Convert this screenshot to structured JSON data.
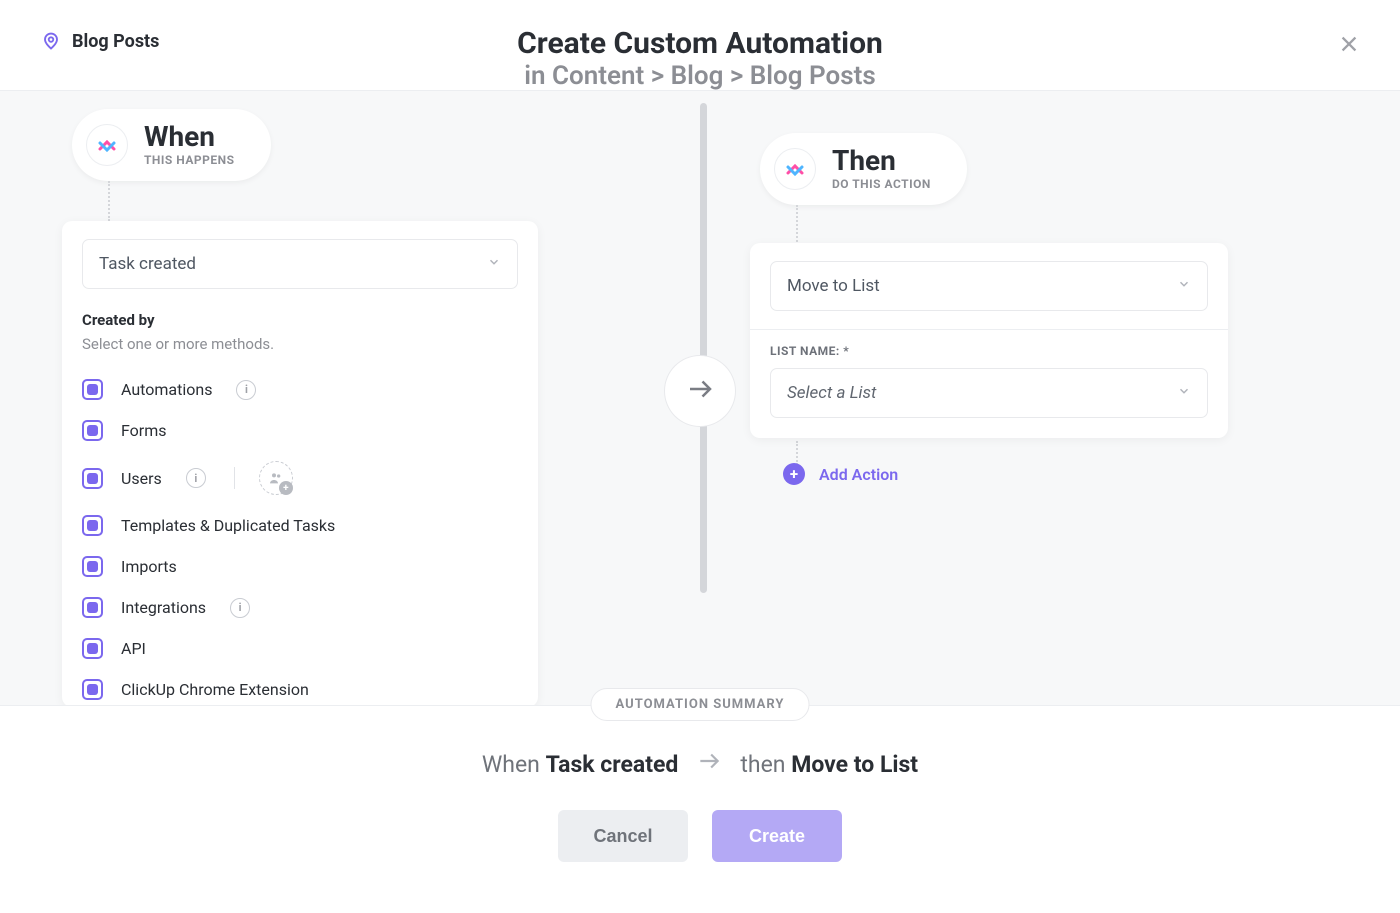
{
  "header": {
    "breadcrumb_label": "Blog Posts",
    "title": "Create Custom Automation",
    "path_prefix": "in ",
    "path": "Content > Blog > Blog Posts"
  },
  "when": {
    "pill_title": "When",
    "pill_sub": "THIS HAPPENS",
    "trigger_selected": "Task created",
    "created_by_label": "Created by",
    "created_by_sub": "Select one or more methods.",
    "methods": [
      {
        "label": "Automations",
        "info": true,
        "people": false
      },
      {
        "label": "Forms",
        "info": false,
        "people": false
      },
      {
        "label": "Users",
        "info": true,
        "people": true
      },
      {
        "label": "Templates & Duplicated Tasks",
        "info": false,
        "people": false
      },
      {
        "label": "Imports",
        "info": false,
        "people": false
      },
      {
        "label": "Integrations",
        "info": true,
        "people": false
      },
      {
        "label": "API",
        "info": false,
        "people": false
      },
      {
        "label": "ClickUp Chrome Extension",
        "info": false,
        "people": false
      }
    ]
  },
  "then": {
    "pill_title": "Then",
    "pill_sub": "DO THIS ACTION",
    "action_selected": "Move to List",
    "list_name_label": "LIST NAME: *",
    "list_placeholder": "Select a List",
    "add_action_label": "Add Action"
  },
  "summary": {
    "pill": "AUTOMATION SUMMARY",
    "when_word": "When",
    "when_value": "Task created",
    "then_word": "then",
    "then_value": "Move to List"
  },
  "footer": {
    "cancel": "Cancel",
    "create": "Create"
  }
}
